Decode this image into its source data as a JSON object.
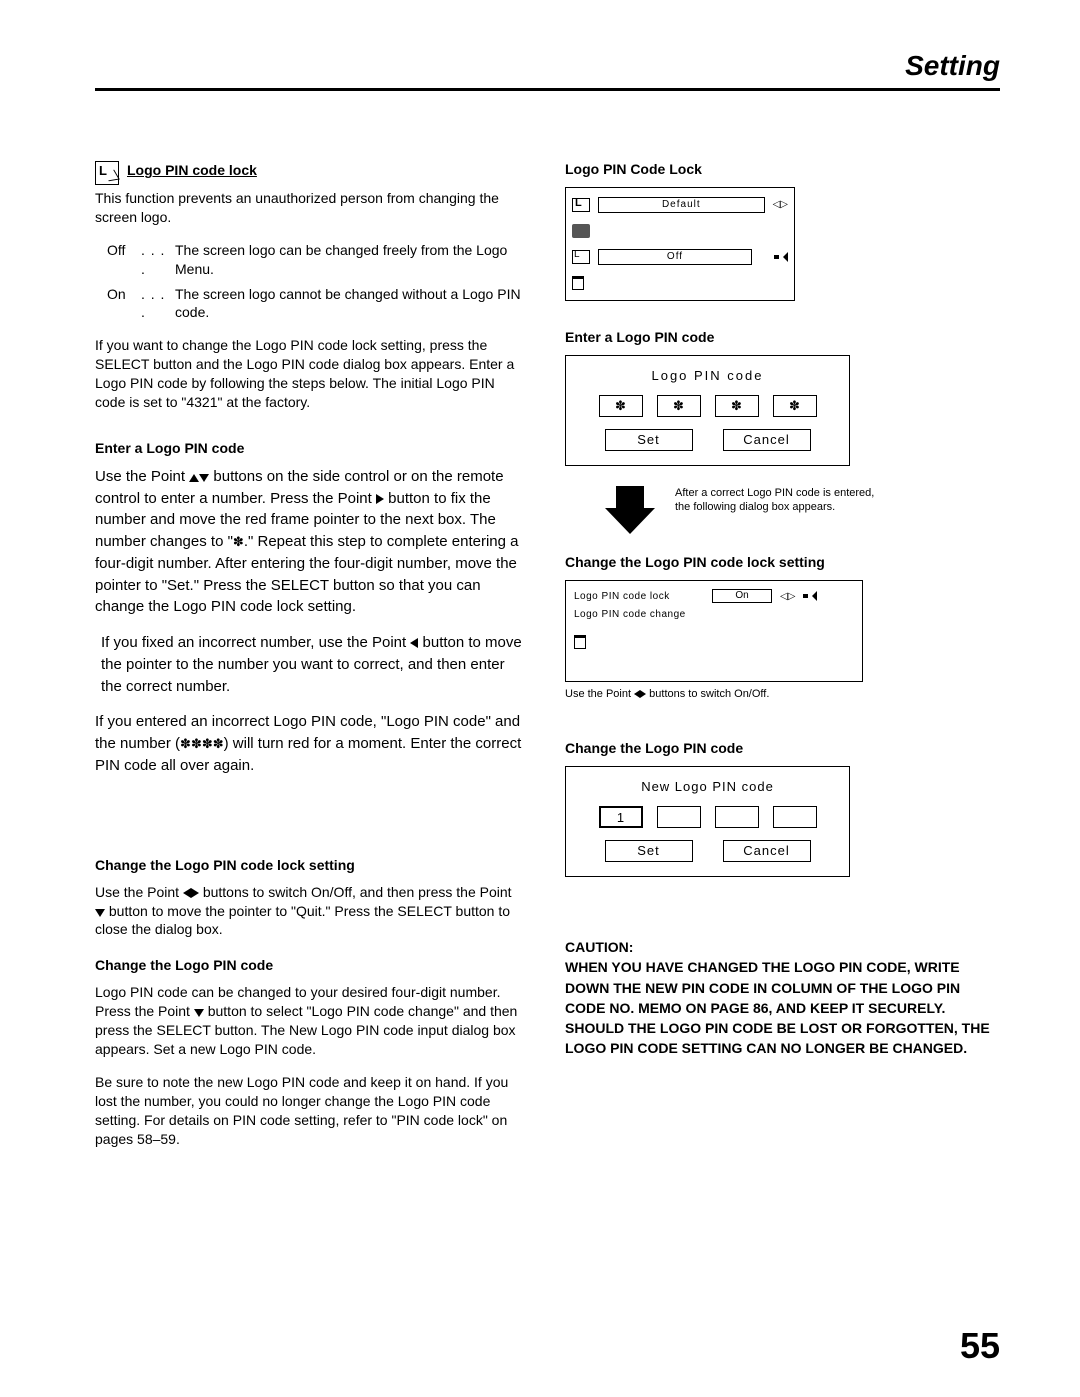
{
  "header": {
    "title": "Setting"
  },
  "page_number": "55",
  "left": {
    "s1_title": "Logo PIN code lock",
    "s1_p1": "This function prevents an unauthorized person from changing the screen logo.",
    "s1_off_label": "Off",
    "s1_off_desc": "The screen logo can be changed freely from the Logo Menu.",
    "s1_on_label": "On",
    "s1_on_desc": "The screen logo cannot be changed without a Logo PIN code.",
    "s1_p2": "If you want to change the Logo PIN code lock setting, press the SELECT button and the Logo PIN code dialog box appears. Enter a Logo PIN code by following the steps below. The initial Logo PIN code is set to \"4321\" at the factory.",
    "s2_title": "Enter a Logo PIN code",
    "s2_p1a": "Use the Point ",
    "s2_p1b": " buttons on the side control or on the remote control to enter a number. Press the Point ",
    "s2_p1c": " button to fix the number and move the red frame pointer to the next box. The number changes to \"",
    "s2_p1d": ".\" Repeat this step to complete entering a four-digit number. After entering the four-digit number, move the pointer to \"Set.\" Press the SELECT button so that you can change the Logo PIN code lock setting.",
    "s2_p2a": "If you fixed an incorrect number, use the Point ",
    "s2_p2b": " button to move the pointer to the number you want to correct, and then enter the correct number.",
    "s2_p3a": "If you entered an incorrect Logo PIN code, \"Logo PIN code\" and the number (",
    "s2_p3b": ") will turn red for a moment. Enter the correct PIN code all over again.",
    "s3_title": "Change the Logo PIN code lock setting",
    "s3_p1a": "Use the Point ",
    "s3_p1b": " buttons to switch On/Off, and then press the Point ",
    "s3_p1c": " button to move the pointer to \"Quit.\" Press the SELECT button to close the dialog box.",
    "s4_title": "Change the Logo PIN code",
    "s4_p1a": "Logo PIN code can be changed to your desired four-digit number. Press the Point ",
    "s4_p1b": " button to select \"Logo PIN code change\" and then press the SELECT button. The New Logo PIN code input dialog box appears. Set a new Logo PIN code.",
    "s4_p2": "Be sure to note the new Logo PIN code and keep it on hand. If you lost the number, you could no longer change the Logo PIN code setting. For details on PIN code setting, refer to \"PIN code lock\" on pages 58–59."
  },
  "right": {
    "r1_title": "Logo PIN Code Lock",
    "fig1": {
      "default": "Default",
      "off": "Off"
    },
    "r2_title": "Enter a Logo PIN code",
    "fig2": {
      "title": "Logo PIN code",
      "star": "✽",
      "set": "Set",
      "cancel": "Cancel"
    },
    "arrow_note": "After a correct Logo PIN code is entered, the following dialog box appears.",
    "r3_title": "Change the Logo PIN code lock setting",
    "fig3": {
      "row1": "Logo PIN code lock",
      "row1_val": "On",
      "row2": "Logo PIN code change"
    },
    "fig3_cap_a": "Use the Point ",
    "fig3_cap_b": " buttons to switch On/Off.",
    "r4_title": "Change the Logo PIN code",
    "fig4": {
      "title": "New Logo PIN code",
      "first": "1",
      "set": "Set",
      "cancel": "Cancel"
    },
    "caution_label": "CAUTION:",
    "caution_body": "WHEN YOU HAVE CHANGED THE LOGO PIN CODE, WRITE DOWN THE NEW PIN CODE IN COLUMN OF THE LOGO PIN CODE NO. MEMO ON PAGE 86, AND KEEP IT SECURELY. SHOULD THE LOGO PIN CODE BE LOST OR FORGOTTEN, THE LOGO PIN CODE SETTING CAN NO LONGER BE CHANGED."
  }
}
